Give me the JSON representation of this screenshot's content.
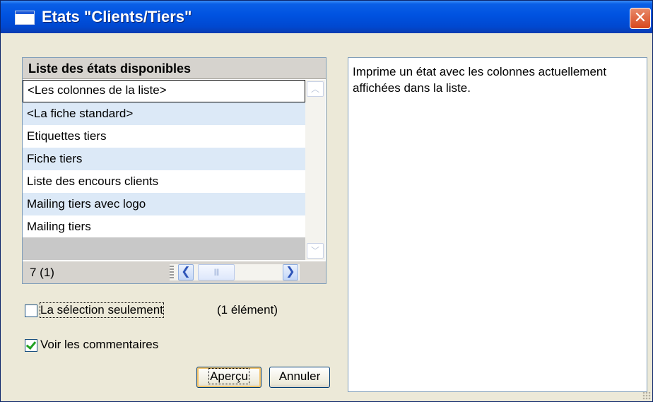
{
  "window": {
    "title": "Etats \"Clients/Tiers\"",
    "close_glyph": "✕",
    "icon": "window-icon",
    "title_bar_color": "#0052e0"
  },
  "report_list": {
    "header": "Liste des états disponibles",
    "items": [
      {
        "label": "<Les colonnes de la liste>",
        "selected": true
      },
      {
        "label": "<La fiche standard>"
      },
      {
        "label": "Etiquettes tiers"
      },
      {
        "label": "Fiche tiers"
      },
      {
        "label": "Liste des encours clients"
      },
      {
        "label": "Mailing tiers avec logo"
      },
      {
        "label": "Mailing tiers"
      }
    ],
    "count": "7 (1)",
    "alt_row_color": "#dce9f7",
    "scroll_up_glyph": "︿",
    "scroll_down_glyph": "﹀",
    "scroll_left_glyph": "❮",
    "scroll_right_glyph": "❯",
    "thumb_glyph": "||||"
  },
  "description": "Imprime un état avec les colonnes actuellement affichées dans la liste.",
  "options": {
    "selection_only": {
      "label": "La sélection seulement",
      "checked": false,
      "count": "(1 élément)"
    },
    "show_comments": {
      "label": "Voir les commentaires",
      "checked": true
    }
  },
  "buttons": {
    "preview": "Aperçu",
    "cancel": "Annuler"
  }
}
